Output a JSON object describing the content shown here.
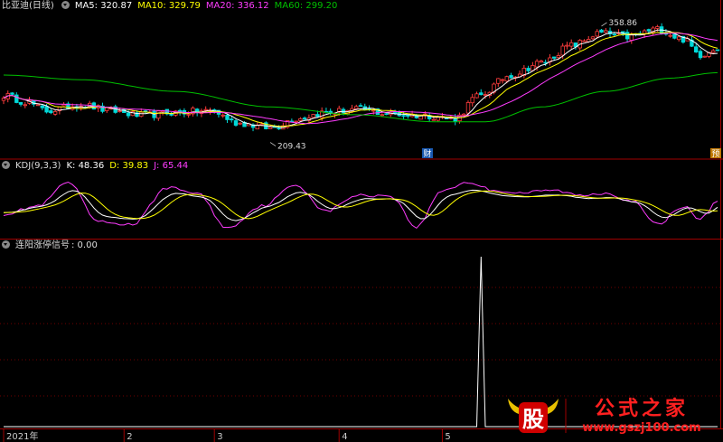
{
  "colors": {
    "up": "#ff3c3c",
    "down": "#00d8d8",
    "ma5": "#ffffff",
    "ma10": "#ffff00",
    "ma20": "#ff3cff",
    "ma60": "#00c000",
    "k": "#ffffff",
    "d": "#ffff00",
    "j": "#ff3cff",
    "signal": "#ffffff",
    "border": "#a00000"
  },
  "panels": {
    "price": {
      "title": "比亚迪(日线)",
      "ma5_label": "MA5: 320.87",
      "ma10_label": "MA10: 329.79",
      "ma20_label": "MA20: 336.12",
      "ma60_label": "MA60: 299.20"
    },
    "kdj": {
      "title": "KDJ(9,3,3)",
      "k_label": "K: 48.36",
      "d_label": "D: 39.83",
      "j_label": "J: 65.44"
    },
    "signal": {
      "title": "连阳涨停信号",
      "value_label": ": 0.00"
    }
  },
  "markers": {
    "cai": "财",
    "yu": "预"
  },
  "logo": {
    "mark": "股",
    "name": "公式之家",
    "url": "www.gszj100.com"
  },
  "chart_data": [
    {
      "type": "candlestick",
      "title": "比亚迪(日线)",
      "price_range": [
        195,
        375
      ],
      "annotations": [
        {
          "label": "209.43",
          "value": 209.43,
          "bar": 62
        },
        {
          "label": "358.86",
          "value": 358.86,
          "bar": 139
        }
      ],
      "series_names": [
        "MA5",
        "MA10",
        "MA20",
        "MA60"
      ],
      "anchors": {
        "close": [
          [
            0,
            270
          ],
          [
            5,
            262
          ],
          [
            10,
            250
          ],
          [
            18,
            258
          ],
          [
            25,
            250
          ],
          [
            32,
            244
          ],
          [
            40,
            248
          ],
          [
            48,
            250
          ],
          [
            55,
            234
          ],
          [
            62,
            228
          ],
          [
            68,
            240
          ],
          [
            75,
            248
          ],
          [
            82,
            252
          ],
          [
            90,
            246
          ],
          [
            98,
            244
          ],
          [
            105,
            240
          ],
          [
            110,
            268
          ],
          [
            118,
            296
          ],
          [
            125,
            312
          ],
          [
            132,
            334
          ],
          [
            139,
            350
          ],
          [
            145,
            345
          ],
          [
            152,
            355
          ],
          [
            158,
            342
          ],
          [
            162,
            322
          ],
          [
            166,
            332
          ]
        ],
        "ma60": [
          [
            0,
            296
          ],
          [
            18,
            290
          ],
          [
            40,
            275
          ],
          [
            62,
            255
          ],
          [
            82,
            245
          ],
          [
            100,
            236
          ],
          [
            112,
            236
          ],
          [
            125,
            255
          ],
          [
            140,
            275
          ],
          [
            155,
            292
          ],
          [
            166,
            299
          ]
        ]
      },
      "last": {
        "ma5": 320.87,
        "ma10": 329.79,
        "ma20": 336.12,
        "ma60": 299.2
      }
    },
    {
      "type": "line",
      "title": "KDJ(9,3,3)",
      "ylim": [
        -10,
        110
      ],
      "series_names": [
        "K",
        "D",
        "J"
      ],
      "anchors": [
        [
          0,
          35
        ],
        [
          8,
          50
        ],
        [
          15,
          95
        ],
        [
          22,
          20
        ],
        [
          30,
          15
        ],
        [
          38,
          85
        ],
        [
          45,
          75
        ],
        [
          52,
          8
        ],
        [
          60,
          50
        ],
        [
          68,
          90
        ],
        [
          75,
          40
        ],
        [
          82,
          70
        ],
        [
          90,
          70
        ],
        [
          96,
          10
        ],
        [
          102,
          80
        ],
        [
          108,
          95
        ],
        [
          114,
          80
        ],
        [
          120,
          75
        ],
        [
          128,
          80
        ],
        [
          134,
          70
        ],
        [
          140,
          75
        ],
        [
          146,
          60
        ],
        [
          152,
          15
        ],
        [
          158,
          50
        ],
        [
          162,
          25
        ],
        [
          166,
          60
        ]
      ],
      "last": {
        "K": 48.36,
        "D": 39.83,
        "J": 65.44
      }
    },
    {
      "type": "line",
      "title": "连阳涨停信号",
      "x_labels": [
        "2021年",
        "2",
        "3",
        "4",
        "5"
      ],
      "x_label_bars": [
        0,
        28,
        49,
        78,
        102
      ],
      "spike": {
        "bar": 111,
        "value": 1
      },
      "last": 0.0
    }
  ]
}
